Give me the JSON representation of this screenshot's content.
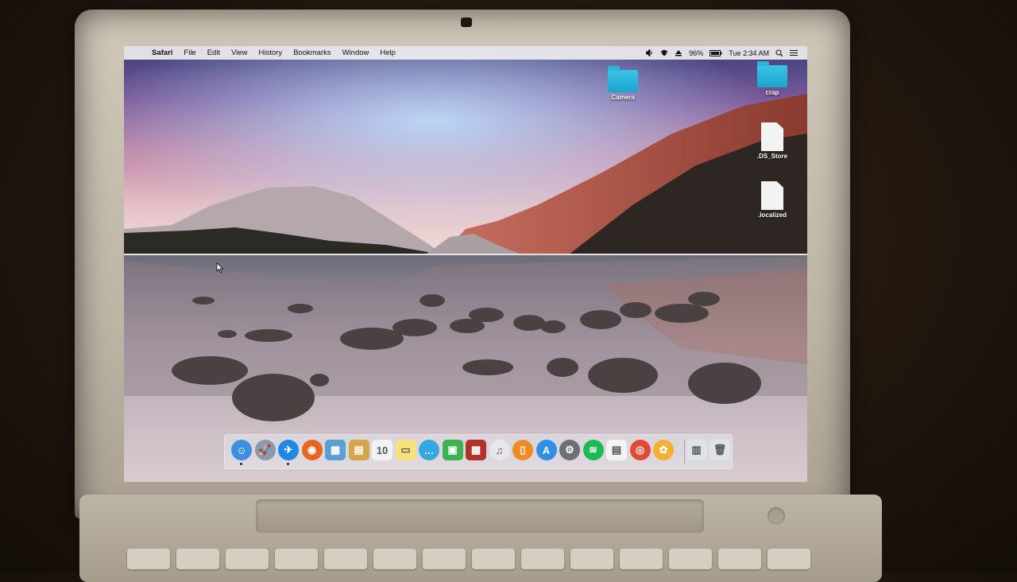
{
  "menubar": {
    "app_name": "Safari",
    "items": [
      "File",
      "Edit",
      "View",
      "History",
      "Bookmarks",
      "Window",
      "Help"
    ],
    "battery": "96%",
    "clock": "Tue 2:34 AM"
  },
  "desktop": {
    "icons": [
      {
        "label": "Camera",
        "kind": "folder"
      },
      {
        "label": "crap",
        "kind": "folder"
      },
      {
        "label": ".DS_Store",
        "kind": "file"
      },
      {
        "label": ".localized",
        "kind": "file"
      }
    ]
  },
  "dock": {
    "apps": [
      {
        "name": "finder-icon",
        "color": "#3e8fe0",
        "glyph": "☺",
        "running": true
      },
      {
        "name": "launchpad-icon",
        "color": "#8a98b0",
        "glyph": "🚀",
        "running": false
      },
      {
        "name": "safari-icon",
        "color": "#1e88e5",
        "glyph": "✈",
        "running": true
      },
      {
        "name": "firefox-icon",
        "color": "#e8651d",
        "glyph": "◉",
        "running": false
      },
      {
        "name": "preview-icon",
        "color": "#5aa0d0",
        "glyph": "▦",
        "running": false
      },
      {
        "name": "notes-folder-icon",
        "color": "#d4a64a",
        "glyph": "▤",
        "running": false
      },
      {
        "name": "calendar-icon",
        "color": "#f2f2f2",
        "glyph": "10",
        "running": false
      },
      {
        "name": "stickies-icon",
        "color": "#f6e27a",
        "glyph": "▭",
        "running": false
      },
      {
        "name": "messages-icon",
        "color": "#35a8e0",
        "glyph": "…",
        "running": false
      },
      {
        "name": "facetime-icon",
        "color": "#3fb34f",
        "glyph": "▣",
        "running": false
      },
      {
        "name": "photo-booth-icon",
        "color": "#b1322b",
        "glyph": "▩",
        "running": false
      },
      {
        "name": "itunes-icon",
        "color": "#e6e6ec",
        "glyph": "♫",
        "running": false
      },
      {
        "name": "ibooks-icon",
        "color": "#f08a24",
        "glyph": "▯",
        "running": false
      },
      {
        "name": "app-store-icon",
        "color": "#2f8ee6",
        "glyph": "A",
        "running": false
      },
      {
        "name": "system-preferences-icon",
        "color": "#6c6f76",
        "glyph": "⚙",
        "running": false
      },
      {
        "name": "spotify-icon",
        "color": "#1db954",
        "glyph": "≋",
        "running": false
      },
      {
        "name": "textedit-icon",
        "color": "#f3f3f3",
        "glyph": "▤",
        "running": false
      },
      {
        "name": "chrome-icon",
        "color": "#e24a33",
        "glyph": "◎",
        "running": false
      },
      {
        "name": "photos-icon",
        "color": "#f4b030",
        "glyph": "✿",
        "running": false
      },
      {
        "name": "downloads-stack-icon",
        "color": "#dfe3e8",
        "glyph": "▥",
        "running": false
      },
      {
        "name": "trash-icon",
        "color": "#dfe3e8",
        "glyph": "🗑",
        "running": false
      }
    ]
  }
}
